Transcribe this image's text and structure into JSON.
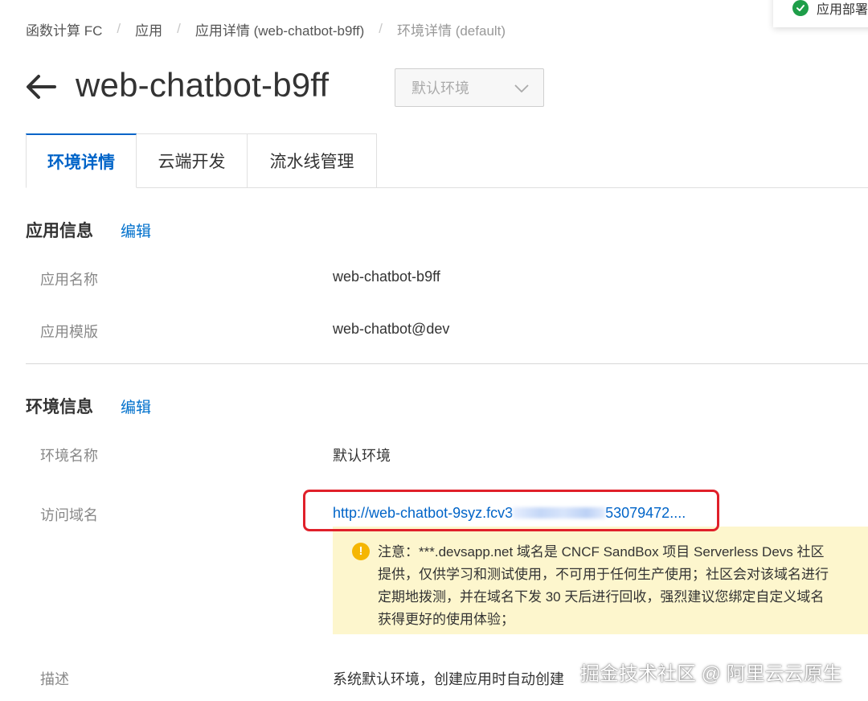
{
  "breadcrumb": [
    "函数计算 FC",
    "应用",
    "应用详情 (web-chatbot-b9ff)",
    "环境详情 (default)"
  ],
  "toast": {
    "text": "应用部署"
  },
  "header": {
    "title": "web-chatbot-b9ff",
    "env_select": "默认环境"
  },
  "tabs": [
    {
      "label": "环境详情",
      "active": true
    },
    {
      "label": "云端开发"
    },
    {
      "label": "流水线管理"
    }
  ],
  "app_info": {
    "title": "应用信息",
    "edit": "编辑",
    "rows": [
      {
        "label": "应用名称",
        "value": "web-chatbot-b9ff"
      },
      {
        "label": "应用模版",
        "value": "web-chatbot@dev"
      }
    ]
  },
  "env_info": {
    "title": "环境信息",
    "edit": "编辑",
    "name_label": "环境名称",
    "name_value": "默认环境",
    "domain_label": "访问域名",
    "domain_prefix": "http://web-chatbot-9syz.fcv3",
    "domain_suffix": "53079472....",
    "notice_lines": [
      "注意：***.devsapp.net 域名是 CNCF SandBox 项目 Serverless Devs 社区",
      "提供，仅供学习和测试使用，不可用于任何生产使用；社区会对该域名进行",
      "定期地拨测，并在域名下发 30 天后进行回收，强烈建议您绑定自定义域名",
      "获得更好的使用体验；"
    ],
    "desc_label": "描述",
    "desc_value": "系统默认环境，创建应用时自动创建"
  },
  "watermark": "掘金技术社区 @ 阿里云云原生",
  "colors": {
    "accent": "#0064c8",
    "notice_bg": "#fdf6cd",
    "highlight": "#e0202a",
    "success": "#1e9e49",
    "warning": "#f5b602"
  }
}
